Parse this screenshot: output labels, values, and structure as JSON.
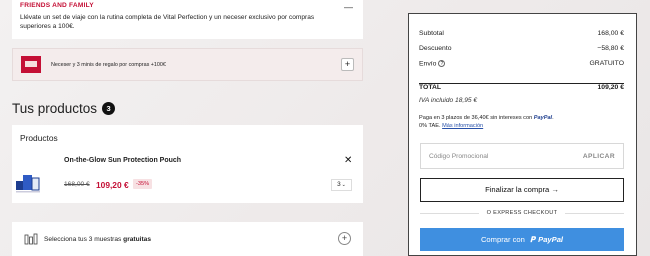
{
  "promo": {
    "title": "FRIENDS AND FAMILY",
    "text": "Llévate un set de viaje con la rutina completa de Vital Perfection y un neceser exclusivo por compras superiores a 100€.",
    "collapse_symbol": "—"
  },
  "gift": {
    "text": "Neceser y 3 minis de regalo por compras +100€",
    "plus_symbol": "+"
  },
  "products_section": {
    "heading": "Tus productos",
    "count": "3",
    "card_title": "Productos"
  },
  "product": {
    "name": "On-the-Glow Sun Protection Pouch",
    "old_price": "168,00 €",
    "new_price": "109,20 €",
    "discount": "-35%",
    "quantity": "3",
    "remove_symbol": "✕"
  },
  "samples": {
    "text_prefix": "Selecciona tus 3 muestras ",
    "text_bold": "gratuitas",
    "plus_symbol": "+"
  },
  "summary": {
    "subtotal_label": "Subtotal",
    "subtotal_value": "168,00 €",
    "discount_label": "Descuento",
    "discount_value": "−58,80 €",
    "shipping_label": "Envío",
    "shipping_value": "GRATUITO",
    "info_icon": "?",
    "total_label": "TOTAL",
    "total_value": "109,20 €",
    "iva": "IVA incluido  18,95 €",
    "paypal_text_1": "Paga en 3 plazos de 36,40€ sin intereses con ",
    "paypal_word": "PayPal",
    "paypal_text_2": "0% TAE.",
    "more_info_link": "Más información",
    "promo_placeholder": "Código Promocional",
    "apply_label": "APLICAR",
    "checkout_label": "Finalizar la compra →",
    "express_label": "O EXPRESS CHECKOUT",
    "paypal_btn_prefix": "Comprar con",
    "paypal_btn_brand": "PayPal"
  }
}
